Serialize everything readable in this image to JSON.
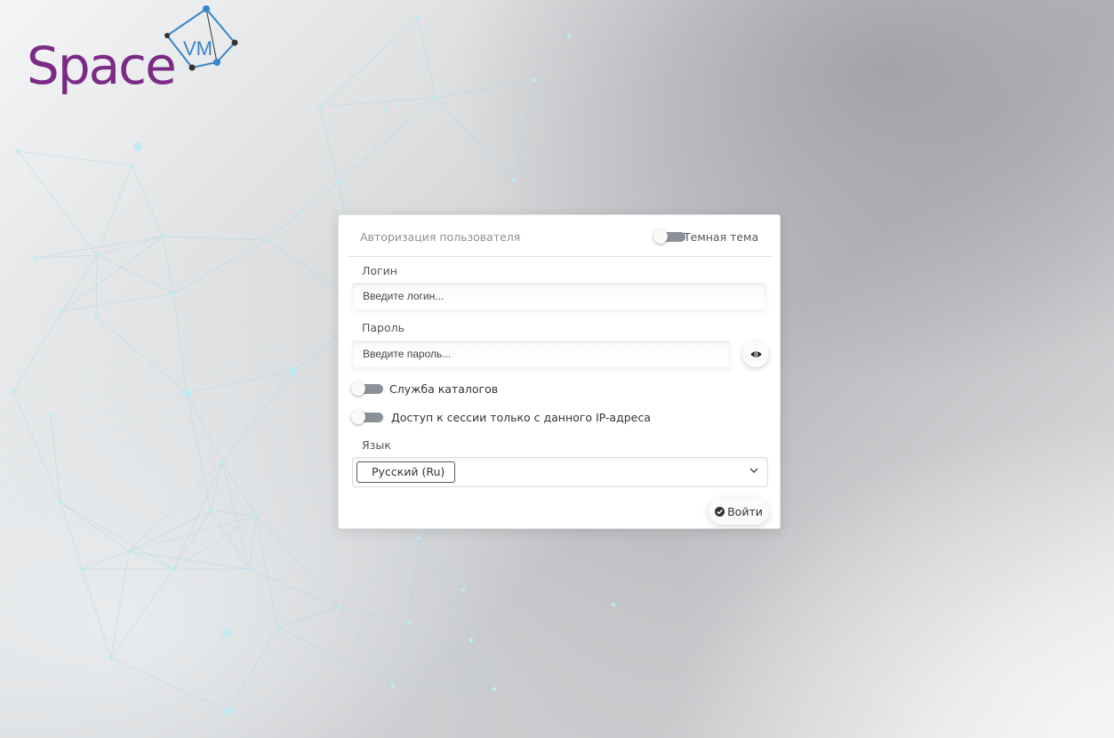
{
  "logo": {
    "text_main": "Space",
    "text_badge": "VM",
    "colors": {
      "main": "#7b2a86",
      "badge": "#3a86c9"
    }
  },
  "auth": {
    "title": "Авторизация пользователя",
    "dark_theme_label": "Темная тема",
    "login": {
      "label": "Логин",
      "placeholder": "Введите логин..."
    },
    "password": {
      "label": "Пароль",
      "placeholder": "Введите пароль..."
    },
    "show_password_icon": "eye-icon",
    "catalog_service_label": "Служба каталогов",
    "ip_session_label": "Доступ к сессии только с данного IP-адреса",
    "language": {
      "label": "Язык",
      "selected": "Русский (Ru)"
    },
    "submit": {
      "label": "Войти",
      "icon": "check-circle-icon"
    }
  }
}
